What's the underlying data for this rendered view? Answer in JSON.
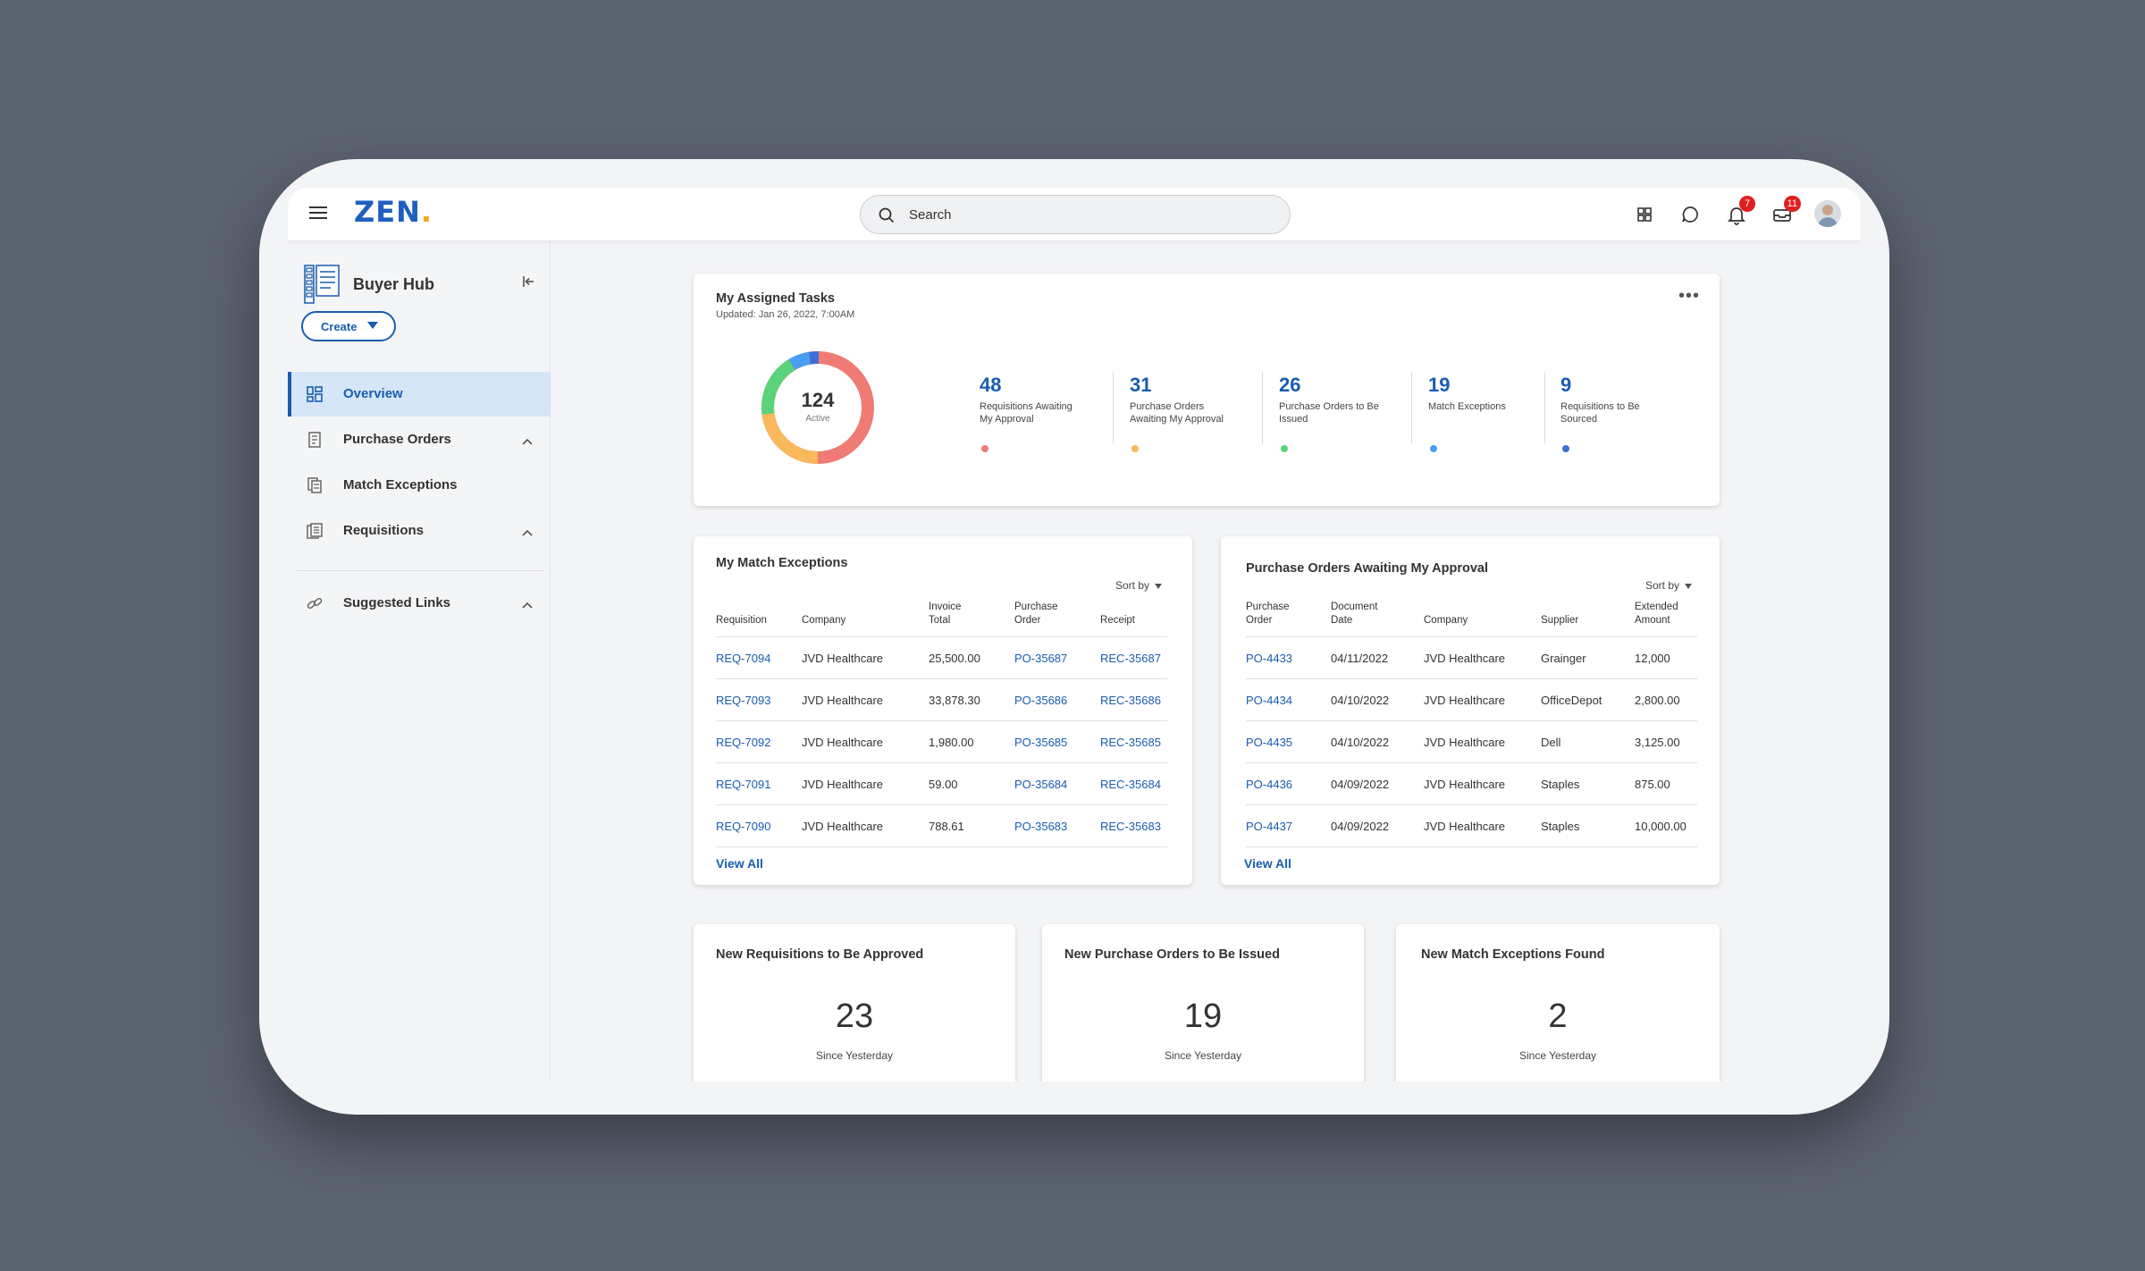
{
  "header": {
    "logo_text": "ZEN",
    "logo_dot": ".",
    "search_placeholder": "Search",
    "notifications_count": "7",
    "inbox_count": "11"
  },
  "sidebar": {
    "hub_title": "Buyer Hub",
    "create_label": "Create",
    "items": [
      {
        "label": "Overview",
        "icon": "dashboard-icon",
        "active": true
      },
      {
        "label": "Purchase Orders",
        "icon": "document-icon",
        "expandable": true
      },
      {
        "label": "Match Exceptions",
        "icon": "document-stack-icon"
      },
      {
        "label": "Requisitions",
        "icon": "list-document-icon",
        "expandable": true
      },
      {
        "label": "Suggested Links",
        "icon": "link-icon",
        "expandable": true
      }
    ]
  },
  "tasks": {
    "title": "My Assigned Tasks",
    "updated": "Updated: Jan 26, 2022, 7:00AM",
    "total": "124",
    "total_label": "Active",
    "metrics": [
      {
        "value": "48",
        "label": "Requisitions Awaiting My Approval",
        "color": "#f07a74"
      },
      {
        "value": "31",
        "label": "Purchase Orders Awaiting My Approval",
        "color": "#f9b85c"
      },
      {
        "value": "26",
        "label": "Purchase Orders to Be Issued",
        "color": "#5cd37a"
      },
      {
        "value": "19",
        "label": "Match Exceptions",
        "color": "#4a9ef0"
      },
      {
        "value": "9",
        "label": "Requisitions to Be Sourced",
        "color": "#3d70d6"
      }
    ]
  },
  "match_exceptions": {
    "title": "My Match Exceptions",
    "sort_label": "Sort by",
    "columns": [
      "Requisition",
      "Company",
      "Invoice Total",
      "Purchase Order",
      "Receipt"
    ],
    "rows": [
      [
        "REQ-7094",
        "JVD Healthcare",
        "25,500.00",
        "PO-35687",
        "REC-35687"
      ],
      [
        "REQ-7093",
        "JVD Healthcare",
        "33,878.30",
        "PO-35686",
        "REC-35686"
      ],
      [
        "REQ-7092",
        "JVD Healthcare",
        "1,980.00",
        "PO-35685",
        "REC-35685"
      ],
      [
        "REQ-7091",
        "JVD Healthcare",
        "59.00",
        "PO-35684",
        "REC-35684"
      ],
      [
        "REQ-7090",
        "JVD Healthcare",
        "788.61",
        "PO-35683",
        "REC-35683"
      ]
    ],
    "view_all": "View All"
  },
  "po_approval": {
    "title": "Purchase Orders Awaiting My Approval",
    "sort_label": "Sort by",
    "columns": [
      "Purchase Order",
      "Document Date",
      "Company",
      "Supplier",
      "Extended Amount"
    ],
    "rows": [
      [
        "PO-4433",
        "04/11/2022",
        "JVD Healthcare",
        "Grainger",
        "12,000"
      ],
      [
        "PO-4434",
        "04/10/2022",
        "JVD Healthcare",
        "OfficeDepot",
        "2,800.00"
      ],
      [
        "PO-4435",
        "04/10/2022",
        "JVD Healthcare",
        "Dell",
        "3,125.00"
      ],
      [
        "PO-4436",
        "04/09/2022",
        "JVD Healthcare",
        "Staples",
        "875.00"
      ],
      [
        "PO-4437",
        "04/09/2022",
        "JVD Healthcare",
        "Staples",
        "10,000.00"
      ]
    ],
    "view_all": "View All"
  },
  "summary": [
    {
      "title": "New Requisitions to Be Approved",
      "value": "23",
      "since": "Since Yesterday"
    },
    {
      "title": "New Purchase Orders to Be Issued",
      "value": "19",
      "since": "Since Yesterday"
    },
    {
      "title": "New Match Exceptions Found",
      "value": "2",
      "since": "Since Yesterday"
    }
  ]
}
